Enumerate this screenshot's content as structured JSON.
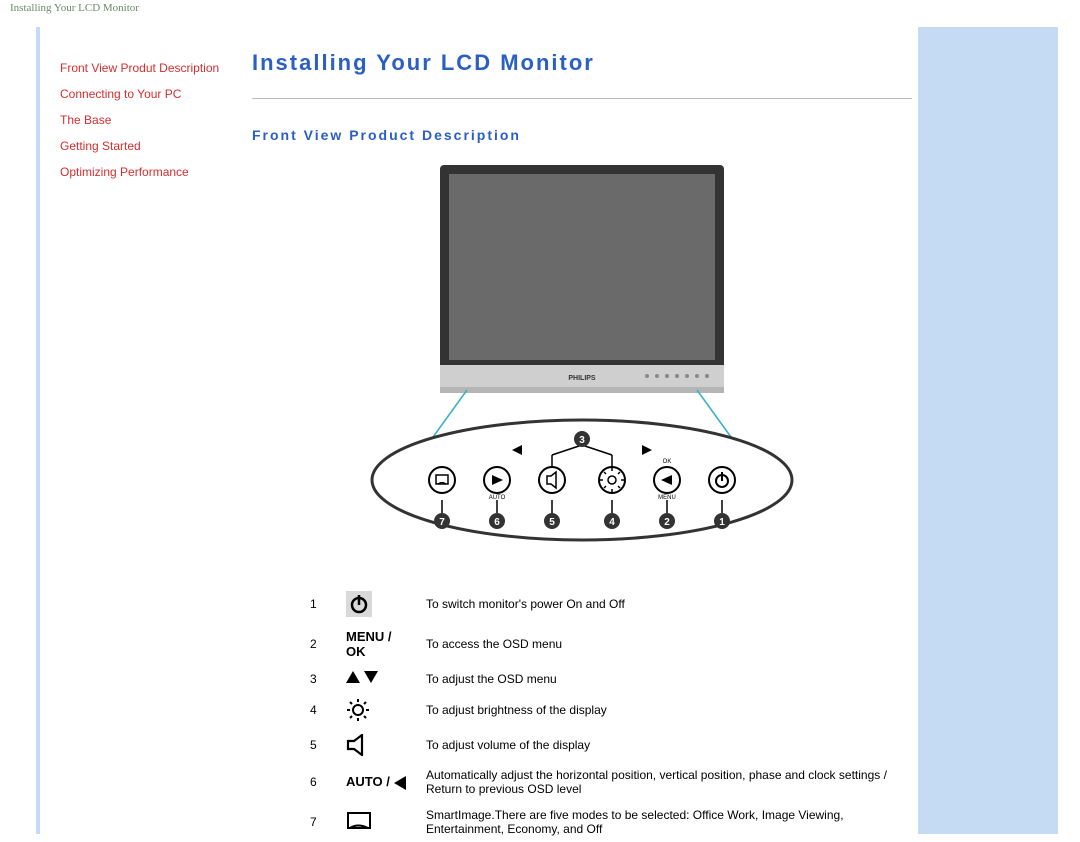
{
  "header_text": "Installing Your LCD Monitor",
  "sidebar": {
    "items": [
      {
        "label": "Front View Produt Description"
      },
      {
        "label": "Connecting to Your PC"
      },
      {
        "label": "The Base"
      },
      {
        "label": "Getting Started"
      },
      {
        "label": "Optimizing Performance"
      }
    ]
  },
  "page": {
    "title": "Installing Your LCD Monitor",
    "section_title": "Front View Product Description"
  },
  "figure": {
    "brand": "PHILIPS",
    "callouts": {
      "top_triangle_left": "◄",
      "top_triangle_right": "►",
      "top_label_ok": "OK",
      "bottom_labels": [
        "AUTO",
        "",
        "",
        "MENU"
      ],
      "numbers_bottom": [
        "7",
        "6",
        "5",
        "4",
        "2",
        "1"
      ],
      "number_top": "3"
    }
  },
  "legend": [
    {
      "n": "1",
      "icon": "power",
      "desc": "To switch monitor's power On and Off"
    },
    {
      "n": "2",
      "icon": "menu",
      "desc": "To access the OSD menu"
    },
    {
      "n": "3",
      "icon": "arrows",
      "desc": "To adjust the OSD menu"
    },
    {
      "n": "4",
      "icon": "sun",
      "desc": "To adjust brightness of the display"
    },
    {
      "n": "5",
      "icon": "vol",
      "desc": "To adjust volume of the display"
    },
    {
      "n": "6",
      "icon": "auto",
      "desc": "Automatically adjust the horizontal position, vertical position, phase and clock settings / Return to previous OSD level"
    },
    {
      "n": "7",
      "icon": "smart",
      "desc": "SmartImage.There are five modes to be selected: Office Work, Image Viewing, Entertainment, Economy, and Off"
    }
  ],
  "icon_text": {
    "menu": "MENU / OK",
    "auto": "AUTO /"
  }
}
